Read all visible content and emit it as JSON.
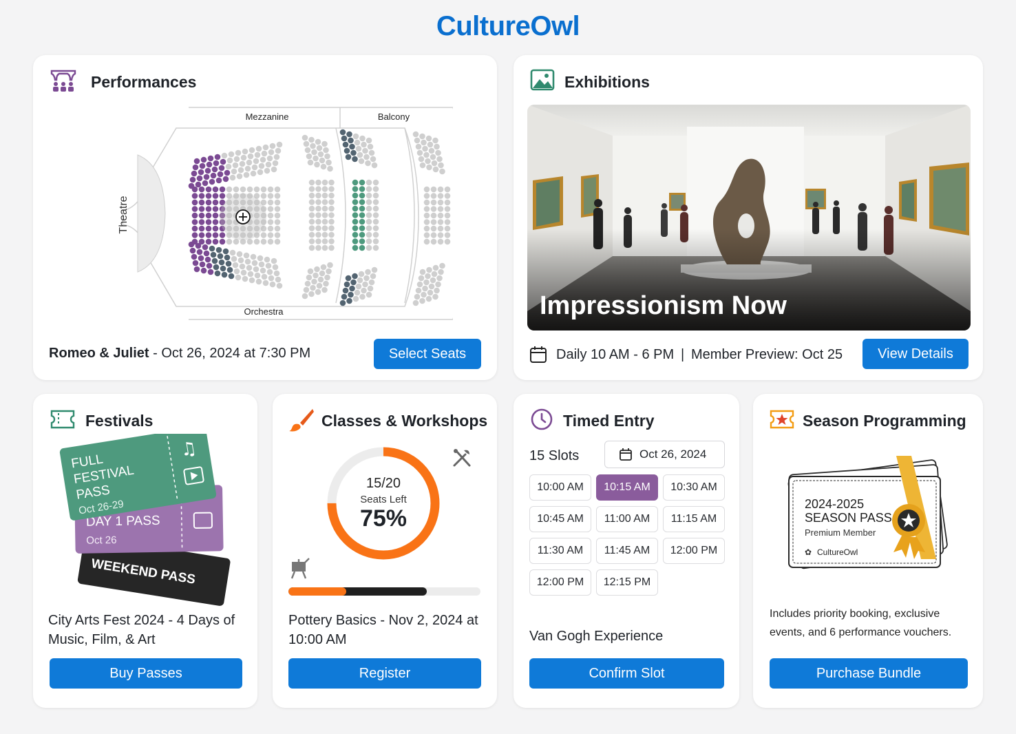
{
  "brand": "CultureOwl",
  "performances": {
    "title": "Performances",
    "section_left": "Theatre",
    "mezzanine": "Mezzanine",
    "balcony": "Balcony",
    "orchestra": "Orchestra",
    "show": "Romeo & Juliet",
    "show_time": " - Oct 26, 2024 at 7:30 PM",
    "button": "Select Seats"
  },
  "exhibitions": {
    "title": "Exhibitions",
    "image_caption": "Impressionism Now",
    "hours": "Daily 10 AM - 6 PM",
    "separator": "|",
    "preview": "Member Preview: Oct 25",
    "button": "View Details"
  },
  "festivals": {
    "title": "Festivals",
    "ticket_full_line1": "FULL",
    "ticket_full_line2": "FESTIVAL",
    "ticket_full_line3": "PASS",
    "ticket_full_dates": "Oct 26-29",
    "ticket_day1": "DAY 1 PASS",
    "ticket_day1_date": "Oct 26",
    "ticket_weekend": "WEEKEND PASS",
    "description": "City Arts Fest 2024 - 4 Days of Music, Film, & Art",
    "button": "Buy Passes"
  },
  "classes": {
    "title": "Classes & Workshops",
    "seats_ratio": "15/20",
    "seats_label": "Seats Left",
    "percent_label": "75%",
    "percent_value": 0.75,
    "progress_orange": 0.3,
    "progress_dark": 0.72,
    "description": "Pottery Basics - Nov 2, 2024 at 10:00 AM",
    "button": "Register"
  },
  "timed": {
    "title": "Timed Entry",
    "slots_count": "15 Slots",
    "date": "Oct 26, 2024",
    "slots": [
      "10:00 AM",
      "10:15 AM",
      "10:30 AM",
      "10:45 AM",
      "11:00 AM",
      "11:15 AM",
      "11:30 AM",
      "11:45 AM",
      "12:00 PM",
      "12:00 PM",
      "12:15 PM"
    ],
    "selected_index": 1,
    "event": "Van Gogh Experience",
    "button": "Confirm Slot"
  },
  "season": {
    "title": "Season Programming",
    "pass_year": "2024-2025",
    "pass_name": "SEASON PASS",
    "pass_member": "Premium Member",
    "pass_brand": "CultureOwl",
    "description": "Includes priority booking, exclusive events, and 6 performance vouchers.",
    "button": "Purchase Bundle"
  },
  "colors": {
    "accent": "#0f7ad8",
    "brand": "#0a6fcf",
    "purple": "#8a5c9c",
    "teal_green": "#4e9a7e",
    "orange": "#f97316"
  }
}
